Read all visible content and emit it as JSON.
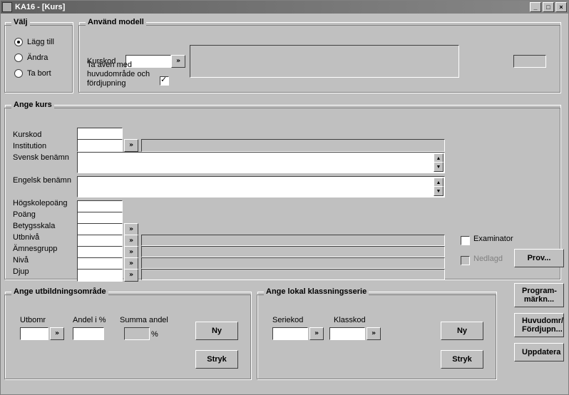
{
  "window": {
    "title": "KA16 - [Kurs]"
  },
  "valj": {
    "legend": "Välj",
    "lagg_till": "Lägg till",
    "andra": "Ändra",
    "ta_bort": "Ta bort"
  },
  "model": {
    "legend": "Använd modell",
    "kurskod_label": "Kurskod",
    "ta_aven_label": "Ta även med huvudområde och fördjupning"
  },
  "kurs": {
    "legend": "Ange kurs",
    "kurskod": "Kurskod",
    "institution": "Institution",
    "svensk": "Svensk benämn",
    "engelsk": "Engelsk benämn",
    "hogskolepoang": "Högskolepoäng",
    "poang": "Poäng",
    "betygsskala": "Betygsskala",
    "utbniva": "Utbnivå",
    "amnesgrupp": "Ämnesgrupp",
    "niva": "Nivå",
    "djup": "Djup",
    "examinator": "Examinator",
    "nedlagd": "Nedlagd"
  },
  "utbomr": {
    "legend": "Ange utbildningsområde",
    "utbomr": "Utbomr",
    "andel": "Andel i %",
    "summa": "Summa andel",
    "percent": "%",
    "ny": "Ny",
    "stryk": "Stryk"
  },
  "klass": {
    "legend": "Ange lokal klassningsserie",
    "seriekod": "Seriekod",
    "klasskod": "Klasskod",
    "ny": "Ny",
    "stryk": "Stryk"
  },
  "rbtns": {
    "prov": "Prov...",
    "program": "Program-\nmärkn...",
    "huvud": "Huvudomr/\nFördjupn...",
    "uppdatera": "Uppdatera"
  },
  "glyphs": {
    "raquo": "»",
    "up": "▲",
    "down": "▼"
  }
}
